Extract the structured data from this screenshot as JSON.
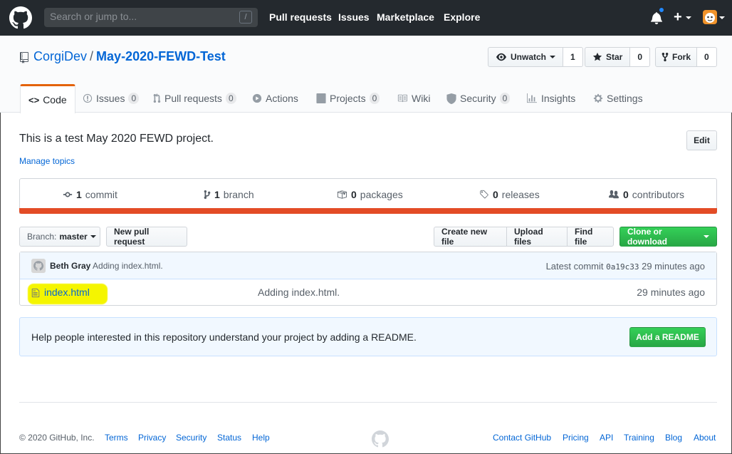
{
  "header": {
    "search_placeholder": "Search or jump to...",
    "search_shortcut": "/",
    "nav": [
      "Pull requests",
      "Issues",
      "Marketplace",
      "Explore"
    ]
  },
  "repo": {
    "owner": "CorgiDev",
    "separator": "/",
    "name": "May-2020-FEWD-Test",
    "watch_label": "Unwatch",
    "watch_count": "1",
    "star_label": "Star",
    "star_count": "0",
    "fork_label": "Fork",
    "fork_count": "0"
  },
  "tabs": [
    {
      "label": "Code",
      "counter": ""
    },
    {
      "label": "Issues",
      "counter": "0"
    },
    {
      "label": "Pull requests",
      "counter": "0"
    },
    {
      "label": "Actions",
      "counter": ""
    },
    {
      "label": "Projects",
      "counter": "0"
    },
    {
      "label": "Wiki",
      "counter": ""
    },
    {
      "label": "Security",
      "counter": "0"
    },
    {
      "label": "Insights",
      "counter": ""
    },
    {
      "label": "Settings",
      "counter": ""
    }
  ],
  "about": {
    "description": "This is a test May 2020 FEWD project.",
    "manage_topics": "Manage topics",
    "edit_label": "Edit"
  },
  "summary": {
    "commits_num": "1",
    "commits_label": "commit",
    "branches_num": "1",
    "branches_label": "branch",
    "packages_num": "0",
    "packages_label": "packages",
    "releases_num": "0",
    "releases_label": "releases",
    "contributors_num": "0",
    "contributors_label": "contributors",
    "language_color": "#e34c26"
  },
  "toolbar": {
    "branch_prefix": "Branch:",
    "branch_name": "master",
    "new_pr": "New pull request",
    "create_file": "Create new file",
    "upload_files": "Upload files",
    "find_file": "Find file",
    "clone": "Clone or download"
  },
  "commit": {
    "author": "Beth Gray",
    "message": "Adding index.html.",
    "latest_label": "Latest commit",
    "sha": "0a19c33",
    "age": "29 minutes ago"
  },
  "files": [
    {
      "name": "index.html",
      "message": "Adding index.html.",
      "age": "29 minutes ago"
    }
  ],
  "readme": {
    "text": "Help people interested in this repository understand your project by adding a README.",
    "button": "Add a README"
  },
  "footer": {
    "copyright": "© 2020 GitHub, Inc.",
    "left_links": [
      "Terms",
      "Privacy",
      "Security",
      "Status",
      "Help"
    ],
    "right_links": [
      "Contact GitHub",
      "Pricing",
      "API",
      "Training",
      "Blog",
      "About"
    ]
  }
}
